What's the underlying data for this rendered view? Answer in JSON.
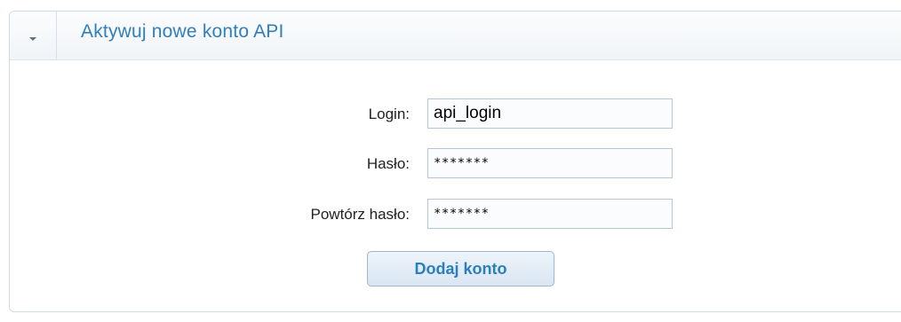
{
  "panel": {
    "title": "Aktywuj nowe konto API",
    "collapse_icon": "chevron-down-icon"
  },
  "form": {
    "login_label": "Login:",
    "login_value": "api_login",
    "password_label": "Hasło:",
    "password_value": "*******",
    "repeat_label": "Powtórz hasło:",
    "repeat_value": "*******",
    "submit_label": "Dodaj konto"
  },
  "colors": {
    "title": "#2f7fbf",
    "button_text": "#2c7fbe",
    "border": "#cfdbe7"
  }
}
